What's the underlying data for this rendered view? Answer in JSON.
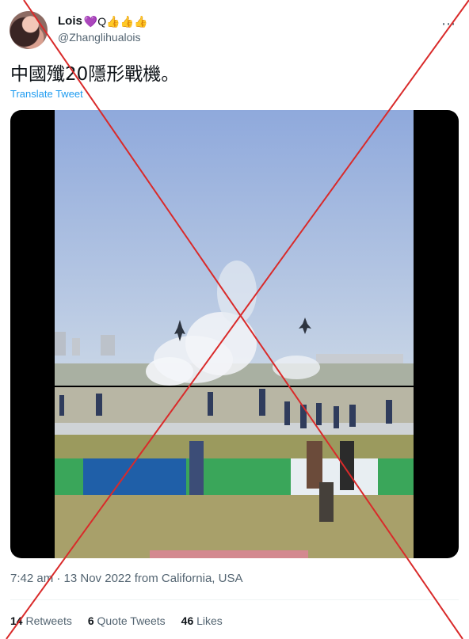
{
  "author": {
    "display_name": "Lois",
    "name_emojis": "💜Q👍👍👍",
    "handle": "@Zhanglihualois"
  },
  "more_icon": "⋯",
  "tweet": {
    "text": "中國殲20隱形戰機。",
    "translate_label": "Translate Tweet"
  },
  "timestamp": "7:42 am · 13 Nov 2022 from California, USA",
  "stats": {
    "retweets_count": "14",
    "retweets_label": "Retweets",
    "quotes_count": "6",
    "quotes_label": "Quote Tweets",
    "likes_count": "46",
    "likes_label": "Likes"
  },
  "colors": {
    "accent": "#1d9bf0",
    "cross": "#d92a2a",
    "secondary_text": "#536471"
  },
  "icons": [
    "avatar",
    "more-icon",
    "cross-mark"
  ]
}
